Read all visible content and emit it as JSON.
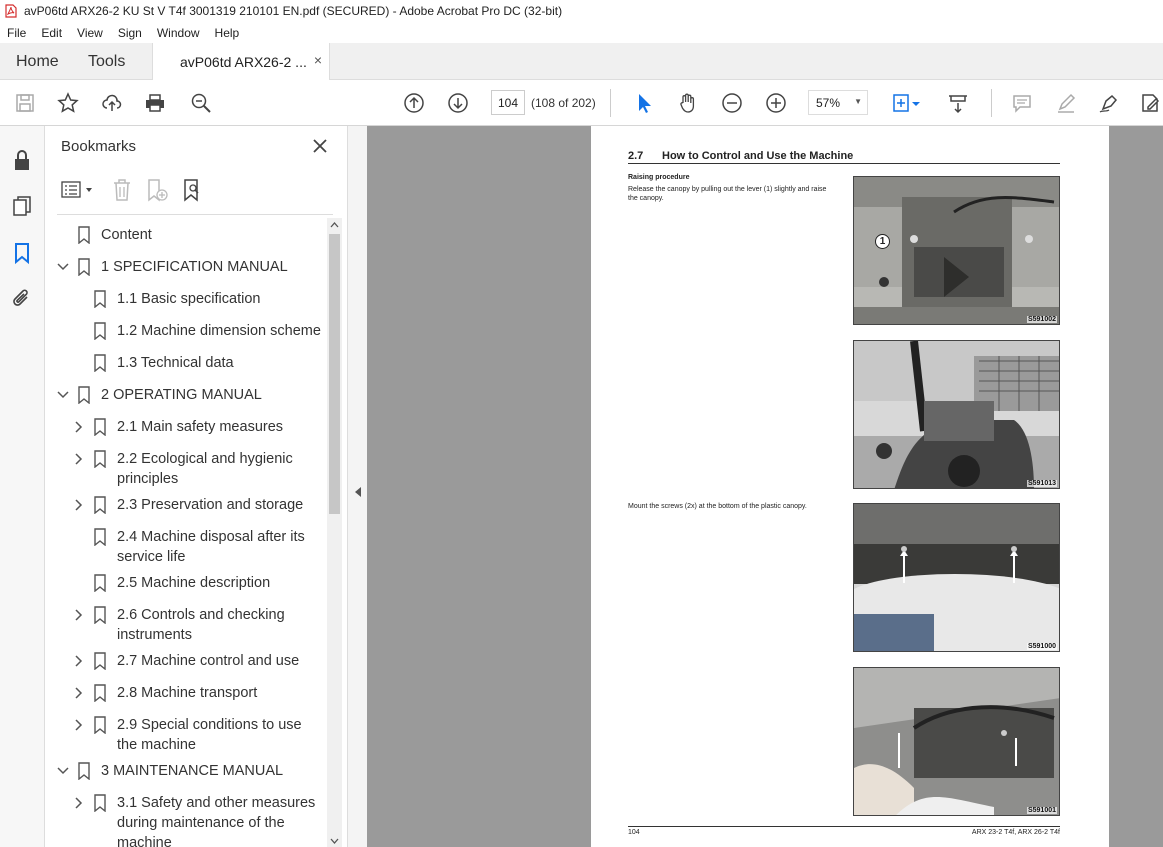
{
  "window": {
    "title": "avP06td ARX26-2 KU St V T4f 3001319 210101 EN.pdf (SECURED) - Adobe Acrobat Pro DC (32-bit)"
  },
  "menu": [
    "File",
    "Edit",
    "View",
    "Sign",
    "Window",
    "Help"
  ],
  "tabs": {
    "home": "Home",
    "tools": "Tools",
    "doc": "avP06td ARX26-2 ...",
    "close": "×"
  },
  "toolbar": {
    "page_current": "104",
    "page_count": "(108 of 202)",
    "zoom": "57%"
  },
  "bookmarks": {
    "title": "Bookmarks",
    "items": [
      {
        "label": "Content",
        "level": 0,
        "chevron": "none"
      },
      {
        "label": "1 SPECIFICATION MANUAL",
        "level": 0,
        "chevron": "down"
      },
      {
        "label": "1.1 Basic specification",
        "level": 1,
        "chevron": "none"
      },
      {
        "label": "1.2 Machine dimension scheme",
        "level": 1,
        "chevron": "none"
      },
      {
        "label": "1.3 Technical data",
        "level": 1,
        "chevron": "none"
      },
      {
        "label": "2 OPERATING MANUAL",
        "level": 0,
        "chevron": "down"
      },
      {
        "label": "2.1 Main safety measures",
        "level": 1,
        "chevron": "right"
      },
      {
        "label": "2.2 Ecological and hygienic",
        "label2": "principles",
        "level": 1,
        "chevron": "right"
      },
      {
        "label": "2.3 Preservation and storage",
        "level": 1,
        "chevron": "right"
      },
      {
        "label": "2.4 Machine disposal after its",
        "label2": "service life",
        "level": 1,
        "chevron": "none"
      },
      {
        "label": "2.5 Machine description",
        "level": 1,
        "chevron": "none"
      },
      {
        "label": "2.6 Controls and checking",
        "label2": "instruments",
        "level": 1,
        "chevron": "right"
      },
      {
        "label": "2.7 Machine control and use",
        "level": 1,
        "chevron": "right"
      },
      {
        "label": "2.8 Machine transport",
        "level": 1,
        "chevron": "right"
      },
      {
        "label": "2.9 Special conditions to use",
        "label2": "the machine",
        "level": 1,
        "chevron": "right"
      },
      {
        "label": "3 MAINTENANCE MANUAL",
        "level": 0,
        "chevron": "down"
      },
      {
        "label": "3.1 Safety and other measures",
        "label2": "during maintenance of the",
        "label3": "machine",
        "level": 1,
        "chevron": "right"
      }
    ]
  },
  "page": {
    "section_number": "2.7",
    "section_title": "How to Control and Use the Machine",
    "raising_heading": "Raising procedure",
    "raising_text_1": "Release the canopy by pulling out the lever (1) slightly and raise",
    "raising_text_2": "the canopy.",
    "mount_text": "Mount the screws (2x) at the bottom of the plastic canopy.",
    "photos": [
      "S591002",
      "S591013",
      "S591000",
      "S591001"
    ],
    "callout": "1",
    "footer_left": "104",
    "footer_right": "ARX 23-2 T4f, ARX 26-2 T4f"
  }
}
